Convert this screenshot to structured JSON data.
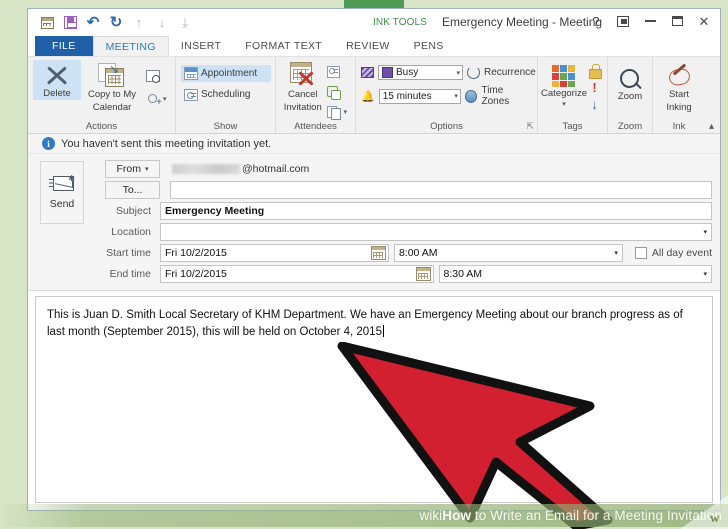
{
  "window": {
    "title": "Emergency Meeting - Meeting",
    "contextual_tab_label": "INK TOOLS",
    "quick_access": [
      {
        "name": "calendar-icon",
        "label": "Calendar"
      },
      {
        "name": "save-icon",
        "label": "Save"
      },
      {
        "name": "undo-icon",
        "label": "Undo",
        "glyph": "↶"
      },
      {
        "name": "redo-icon",
        "label": "Redo",
        "glyph": "↻"
      },
      {
        "name": "previous-item-icon",
        "label": "Previous Item",
        "glyph": "↑"
      },
      {
        "name": "next-item-icon",
        "label": "Next Item",
        "glyph": "↓"
      },
      {
        "name": "customize-qat-icon",
        "label": "Customize Quick Access Toolbar",
        "glyph": "⤓"
      }
    ],
    "controls": [
      {
        "name": "help-button",
        "glyph": "?"
      },
      {
        "name": "ribbon-display-options-button",
        "glyph": "⬒"
      },
      {
        "name": "minimize-button",
        "glyph": "—"
      },
      {
        "name": "maximize-button",
        "glyph": "□"
      },
      {
        "name": "close-button",
        "glyph": "✕"
      }
    ]
  },
  "ribbon": {
    "tabs": [
      {
        "label": "FILE",
        "state": "file"
      },
      {
        "label": "MEETING",
        "state": "active"
      },
      {
        "label": "INSERT",
        "state": "normal"
      },
      {
        "label": "FORMAT TEXT",
        "state": "normal"
      },
      {
        "label": "REVIEW",
        "state": "normal"
      },
      {
        "label": "PENS",
        "state": "normal"
      }
    ],
    "groups": {
      "actions": {
        "name": "Actions",
        "delete": "Delete",
        "copy_to_my_calendar": "Copy to My\nCalendar",
        "copy_to_my_calendar_line1": "Copy to My",
        "copy_to_my_calendar_line2": "Calendar",
        "small_buttons": [
          "Find Related",
          "Other Actions"
        ]
      },
      "show": {
        "name": "Show",
        "appointment": "Appointment",
        "scheduling": "Scheduling"
      },
      "attendees": {
        "name": "Attendees",
        "cancel_invitation_line1": "Cancel",
        "cancel_invitation_line2": "Invitation",
        "small_buttons": [
          "Address Book",
          "Check Names",
          "Response Options"
        ]
      },
      "options": {
        "name": "Options",
        "show_as_value": "Busy",
        "reminder_value": "15 minutes",
        "recurrence": "Recurrence",
        "time_zones": "Time Zones"
      },
      "tags": {
        "name": "Tags",
        "categorize": "Categorize"
      },
      "zoom": {
        "name": "Zoom",
        "zoom": "Zoom"
      },
      "ink": {
        "name": "Ink",
        "start_inking_line1": "Start",
        "start_inking_line2": "Inking"
      }
    }
  },
  "infobar": {
    "icon": "info-icon",
    "message": "You haven't sent this meeting invitation yet."
  },
  "form": {
    "send_button": "Send",
    "from_button": "From",
    "from_value_suffix": "@hotmail.com",
    "to_button": "To...",
    "to_value": "",
    "subject_label": "Subject",
    "subject_value": "Emergency Meeting",
    "location_label": "Location",
    "location_value": "",
    "start_time_label": "Start time",
    "start_date_value": "Fri 10/2/2015",
    "start_time_value": "8:00 AM",
    "end_time_label": "End time",
    "end_date_value": "Fri 10/2/2015",
    "end_time_value": "8:30 AM",
    "all_day_label": "All day event",
    "all_day_checked": false
  },
  "body": {
    "text": "This is Juan D. Smith Local Secretary of KHM Department. We have an Emergency Meeting about our branch progress as of last month (September 2015), this will be held on October 4, 2015"
  },
  "watermark": {
    "brand_prefix": "wiki",
    "brand_suffix": "How",
    "tail": " to Write an Email for a Meeting Invitation"
  },
  "colors": {
    "outer_green": "#d7e4c6",
    "file_tab_blue": "#1e5fa8",
    "active_tab_text": "#2b7cb5",
    "contextual_green": "#4d9b55",
    "ribbon_bg": "#f1f1f1",
    "arrow_red": "#d32030",
    "info_blue": "#2e7cc4"
  }
}
